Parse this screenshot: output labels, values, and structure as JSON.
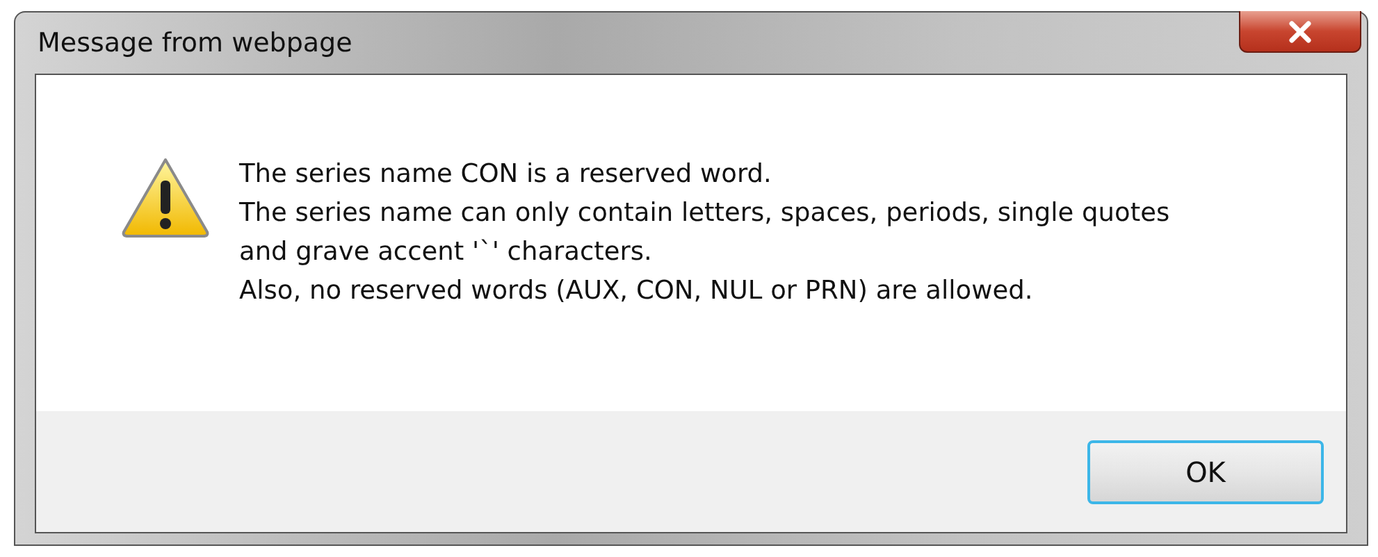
{
  "window": {
    "title": "Message from webpage"
  },
  "message": {
    "lines": [
      "The series name CON is a reserved word.",
      "The series name can only contain letters, spaces, periods, single quotes",
      "and grave accent '`' characters.",
      "Also, no reserved words (AUX, CON, NUL or PRN) are allowed."
    ]
  },
  "buttons": [
    {
      "label": "OK",
      "selected": true
    }
  ]
}
